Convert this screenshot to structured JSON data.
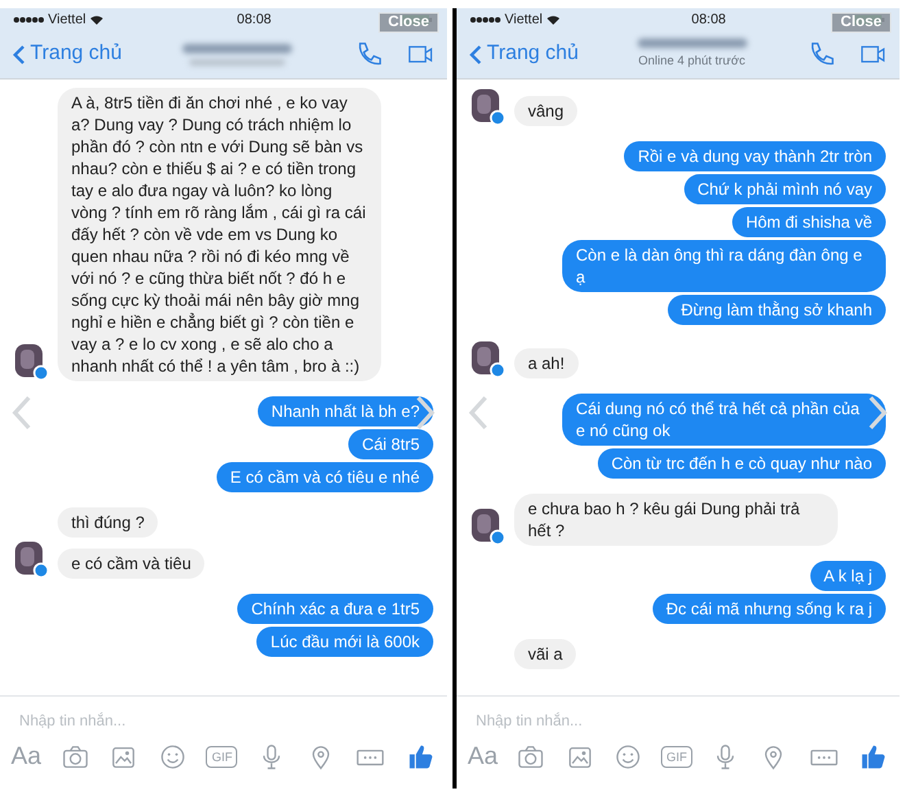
{
  "panels": [
    {
      "status_bar": {
        "carrier": "Viettel",
        "time": "08:08"
      },
      "close_button": "Close",
      "header": {
        "back_label": "Trang chủ"
      },
      "messages": [
        {
          "kind": "received",
          "avatar": true,
          "text": "A à, 8tr5 tiền đi ăn chơi nhé , e ko vay a? Dung vay ? Dung có trách nhiệm lo phần đó ? còn ntn e với Dung sẽ bàn vs nhau? còn e thiếu $ ai ? e có tiền trong tay e alo đưa ngay và luôn? ko lòng vòng ? tính em rõ ràng lắm , cái gì ra cái đấy hết ? còn về vde em vs Dung ko quen nhau nữa ? rồi nó đi kéo mng về với nó ? e cũng thừa biết nốt ? đó h e sống cực kỳ thoải mái nên bây giờ mng nghỉ e hiền e chẳng biết gì ? còn tiền e vay a ? e lo cv xong , e sẽ alo cho a nhanh nhất có thể ! a yên tâm , bro à ::)"
        },
        {
          "kind": "sent",
          "text": "Nhanh nhất là bh e?"
        },
        {
          "kind": "sent",
          "text": "Cái 8tr5"
        },
        {
          "kind": "sent",
          "text": "E có cầm và có tiêu e nhé"
        },
        {
          "kind": "received",
          "avatar": false,
          "text": "thì đúng ?"
        },
        {
          "kind": "received",
          "avatar": true,
          "text": "e có cầm và tiêu"
        },
        {
          "kind": "sent",
          "text": "Chính xác a đưa e 1tr5"
        },
        {
          "kind": "sent",
          "text": "Lúc đầu mới là 600k"
        }
      ],
      "composer": {
        "placeholder": "Nhập tin nhắn...",
        "text_button": "Aa",
        "gif_button": "GIF"
      }
    },
    {
      "status_bar": {
        "carrier": "Viettel",
        "time": "08:08"
      },
      "close_button": "Close",
      "header": {
        "back_label": "Trang chủ",
        "subtitle": "Online 4 phút trước"
      },
      "messages": [
        {
          "kind": "received",
          "avatar": true,
          "text": "vâng"
        },
        {
          "kind": "sent",
          "text": "Rồi e và dung vay thành 2tr tròn"
        },
        {
          "kind": "sent",
          "text": "Chứ k phải mình nó vay"
        },
        {
          "kind": "sent",
          "text": "Hôm đi shisha về"
        },
        {
          "kind": "sent",
          "text": "Còn e là dàn ông thì ra dáng đàn ông e ạ"
        },
        {
          "kind": "sent",
          "text": "Đừng làm thằng sở khanh"
        },
        {
          "kind": "received",
          "avatar": true,
          "text": "a ah!"
        },
        {
          "kind": "sent",
          "text": "Cái dung nó có thể trả hết cả phần của e nó cũng ok"
        },
        {
          "kind": "sent",
          "text": "Còn từ trc đến h e cò quay như nào"
        },
        {
          "kind": "received",
          "avatar": true,
          "text": "e chưa bao h ? kêu gái Dung phải trả hết ?"
        },
        {
          "kind": "sent",
          "text": "A k lạ j"
        },
        {
          "kind": "sent",
          "text": "Đc cái mã nhưng sống k ra j"
        },
        {
          "kind": "received",
          "avatar": false,
          "text": "vãi a"
        }
      ],
      "composer": {
        "placeholder": "Nhập tin nhắn...",
        "text_button": "Aa",
        "gif_button": "GIF"
      }
    }
  ]
}
